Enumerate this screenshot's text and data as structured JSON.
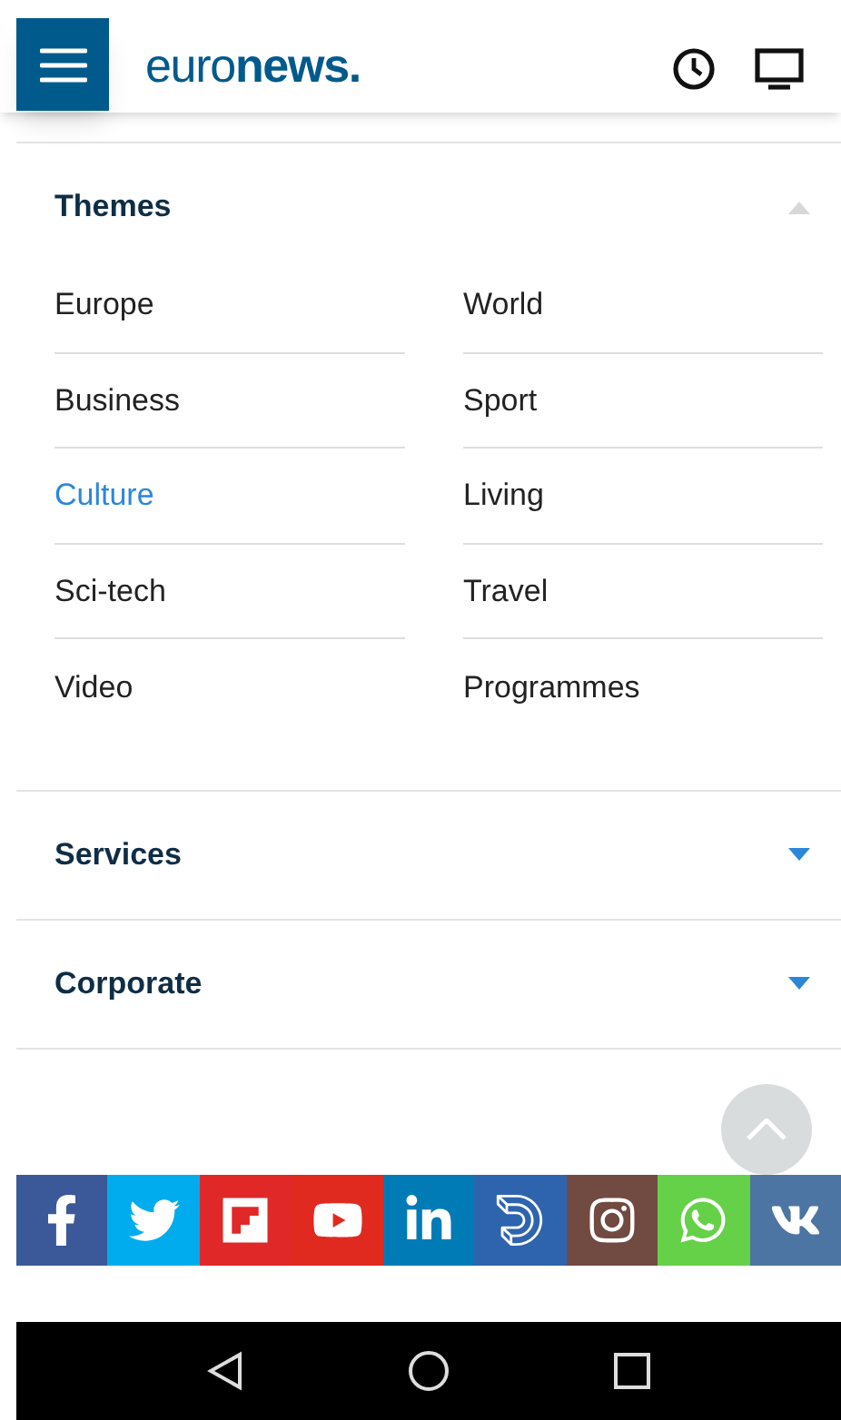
{
  "header": {
    "logo": "euro**news.**"
  },
  "sections": [
    {
      "title": "Themes",
      "expanded": true,
      "items": [
        {
          "label": "Europe",
          "selected": false
        },
        {
          "label": "World",
          "selected": false
        },
        {
          "label": "Business",
          "selected": false
        },
        {
          "label": "Sport",
          "selected": false
        },
        {
          "label": "Culture",
          "selected": true
        },
        {
          "label": "Living",
          "selected": false
        },
        {
          "label": "Sci-tech",
          "selected": false
        },
        {
          "label": "Travel",
          "selected": false
        },
        {
          "label": "Video",
          "selected": false
        },
        {
          "label": "Programmes",
          "selected": false
        }
      ]
    },
    {
      "title": "Services",
      "expanded": false
    },
    {
      "title": "Corporate",
      "expanded": false
    }
  ],
  "social": [
    {
      "kind": "facebook",
      "color": "#3b5998"
    },
    {
      "kind": "twitter",
      "color": "#00aced"
    },
    {
      "kind": "flipboard",
      "color": "#e12828"
    },
    {
      "kind": "youtube",
      "color": "#e02a20"
    },
    {
      "kind": "linkedin",
      "color": "#007bb6"
    },
    {
      "kind": "dailymotion",
      "color": "#2e64ae"
    },
    {
      "kind": "instagram",
      "color": "#714a42"
    },
    {
      "kind": "whatsapp",
      "color": "#65d148"
    },
    {
      "kind": "vk",
      "color": "#4c75a3"
    }
  ]
}
